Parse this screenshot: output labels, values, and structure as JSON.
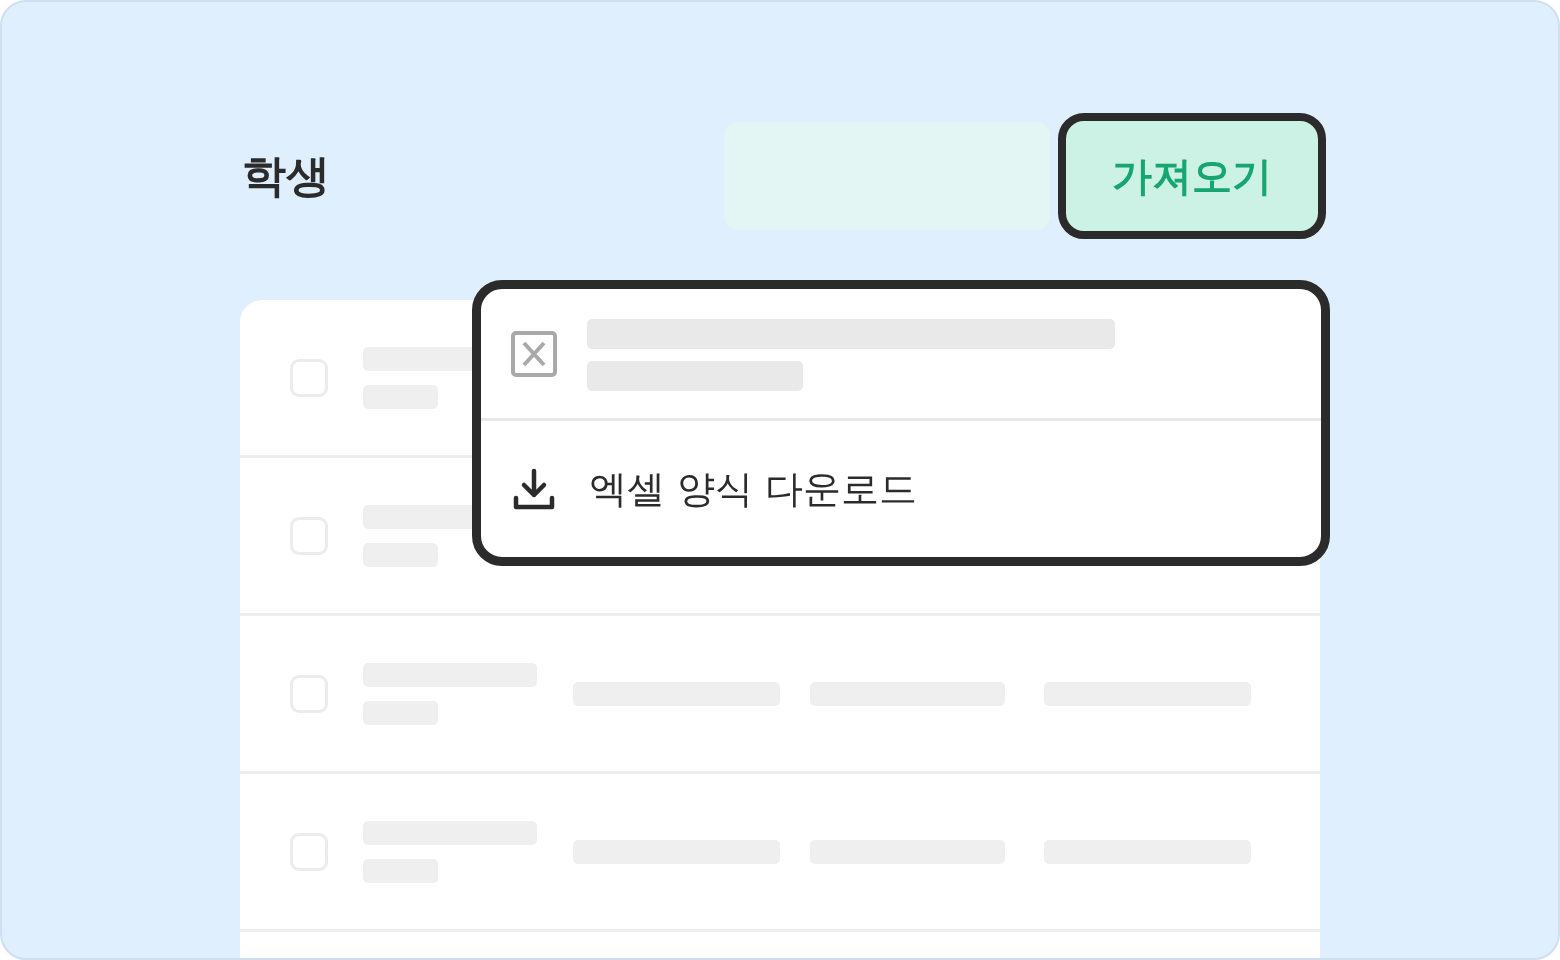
{
  "header": {
    "title": "학생",
    "import_button": {
      "label": "가져오기",
      "pressed": true
    }
  },
  "dropdown": {
    "items": [
      {
        "kind": "skeleton"
      },
      {
        "kind": "action",
        "label": "엑셀 양식 다운로드"
      }
    ]
  },
  "table": {
    "rows": [
      {
        "kind": "covered",
        "checked": false
      },
      {
        "kind": "covered",
        "checked": false
      },
      {
        "kind": "full",
        "checked": false
      },
      {
        "kind": "full",
        "checked": false
      }
    ]
  }
}
